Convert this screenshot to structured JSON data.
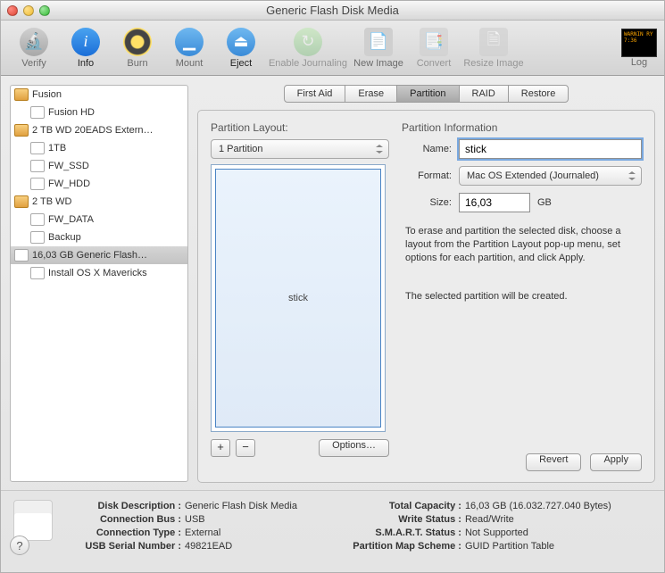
{
  "window": {
    "title": "Generic Flash Disk Media"
  },
  "toolbar": {
    "verify": "Verify",
    "info": "Info",
    "burn": "Burn",
    "mount": "Mount",
    "eject": "Eject",
    "enable_journaling": "Enable Journaling",
    "new_image": "New Image",
    "convert": "Convert",
    "resize_image": "Resize Image",
    "log": "Log",
    "log_text": "WARNIN\nRY 7:36"
  },
  "sidebar": {
    "items": [
      {
        "label": "Fusion",
        "type": "hdd"
      },
      {
        "label": "Fusion HD",
        "type": "vol",
        "child": true
      },
      {
        "label": "2 TB WD 20EADS Extern…",
        "type": "hdd"
      },
      {
        "label": "1TB",
        "type": "vol",
        "child": true
      },
      {
        "label": "FW_SSD",
        "type": "vol",
        "child": true
      },
      {
        "label": "FW_HDD",
        "type": "vol",
        "child": true
      },
      {
        "label": "2 TB WD",
        "type": "hdd"
      },
      {
        "label": "FW_DATA",
        "type": "vol",
        "child": true
      },
      {
        "label": "Backup",
        "type": "vol",
        "child": true
      },
      {
        "label": "16,03 GB Generic Flash…",
        "type": "vol",
        "selected": true
      },
      {
        "label": "Install OS X Mavericks",
        "type": "vol",
        "child": true
      }
    ]
  },
  "tabs": {
    "first_aid": "First Aid",
    "erase": "Erase",
    "partition": "Partition",
    "raid": "RAID",
    "restore": "Restore",
    "active": "partition"
  },
  "partition": {
    "layout_title": "Partition Layout:",
    "layout_value": "1 Partition",
    "preview_label": "stick",
    "add": "+",
    "remove": "−",
    "options": "Options…",
    "info_title": "Partition Information",
    "name_label": "Name:",
    "name_value": "stick",
    "format_label": "Format:",
    "format_value": "Mac OS Extended (Journaled)",
    "size_label": "Size:",
    "size_value": "16,03",
    "size_unit": "GB",
    "desc1": "To erase and partition the selected disk, choose a layout from the Partition Layout pop-up menu, set options for each partition, and click Apply.",
    "desc2": "The selected partition will be created.",
    "revert": "Revert",
    "apply": "Apply"
  },
  "footer": {
    "col1": {
      "disk_description": {
        "k": "Disk Description :",
        "v": "Generic Flash Disk Media"
      },
      "connection_bus": {
        "k": "Connection Bus :",
        "v": "USB"
      },
      "connection_type": {
        "k": "Connection Type :",
        "v": "External"
      },
      "usb_serial": {
        "k": "USB Serial Number :",
        "v": "49821EAD"
      }
    },
    "col2": {
      "total_capacity": {
        "k": "Total Capacity :",
        "v": "16,03 GB (16.032.727.040 Bytes)"
      },
      "write_status": {
        "k": "Write Status :",
        "v": "Read/Write"
      },
      "smart_status": {
        "k": "S.M.A.R.T. Status :",
        "v": "Not Supported"
      },
      "partition_map": {
        "k": "Partition Map Scheme :",
        "v": "GUID Partition Table"
      }
    },
    "help": "?"
  }
}
